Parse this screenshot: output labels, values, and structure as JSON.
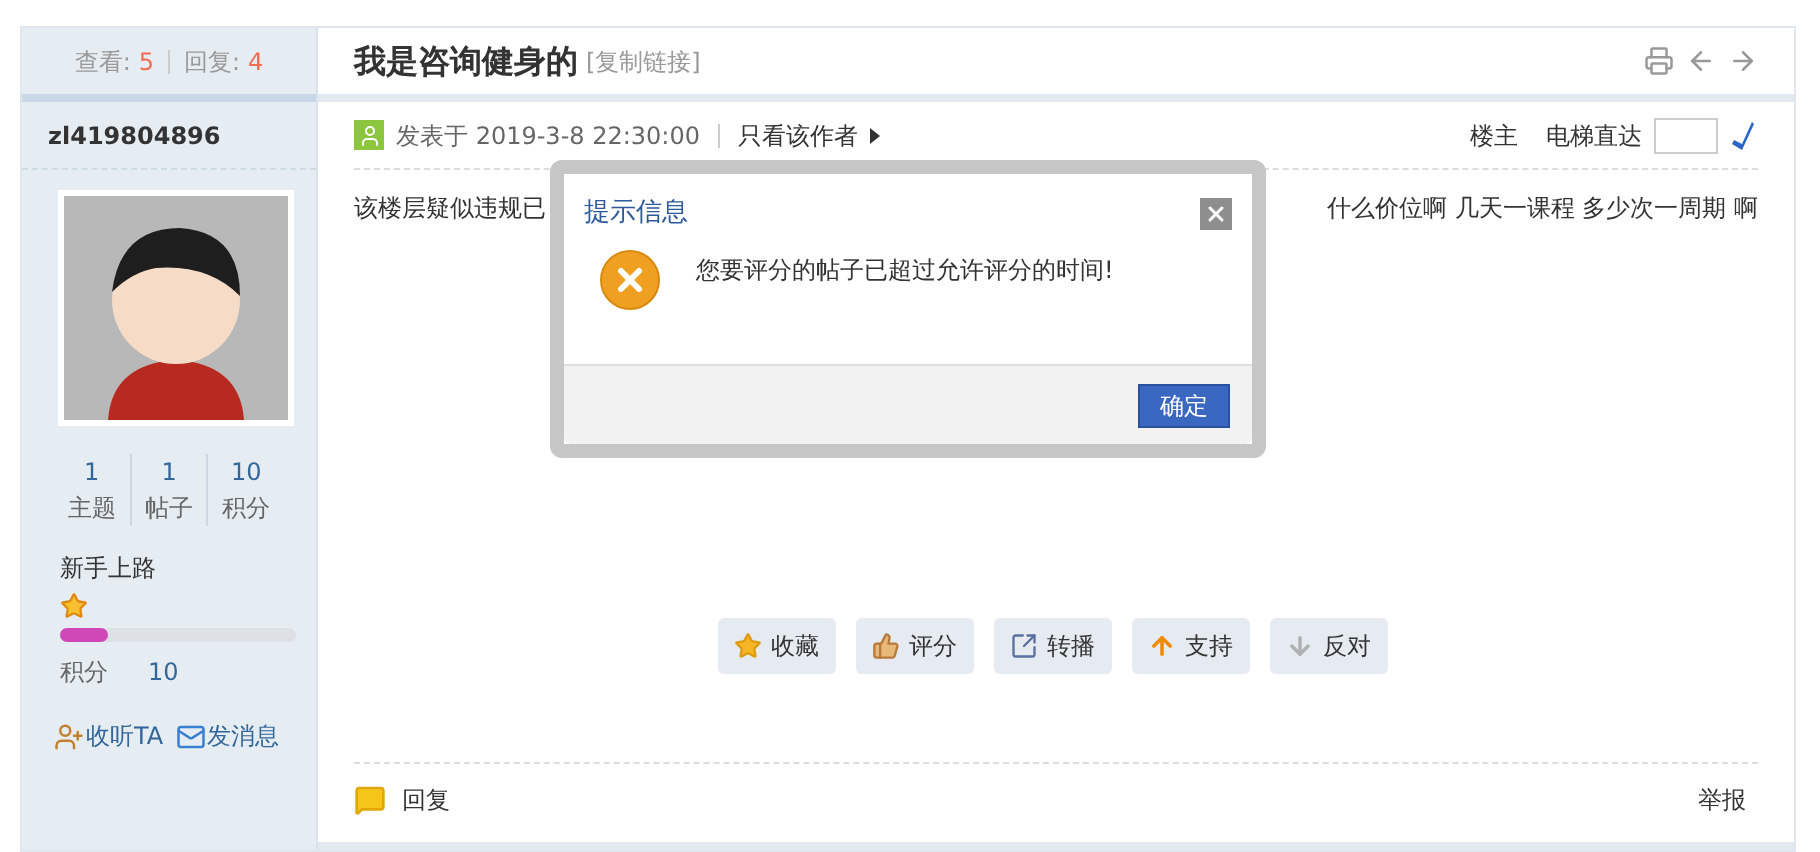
{
  "thread": {
    "views_label": "查看:",
    "views": "5",
    "replies_label": "回复:",
    "replies": "4",
    "title": "我是咨询健身的",
    "copy_link": "[复制链接]"
  },
  "author": {
    "name": "zl419804896",
    "stats": [
      {
        "value": "1",
        "label": "主题"
      },
      {
        "value": "1",
        "label": "帖子"
      },
      {
        "value": "10",
        "label": "积分"
      }
    ],
    "rank": "新手上路",
    "level": 0.2,
    "points_label": "积分",
    "points": "10",
    "actions": [
      {
        "kind": "follow",
        "label": "收听TA"
      },
      {
        "kind": "message",
        "label": "发消息"
      }
    ]
  },
  "post": {
    "posted": "发表于 2019-3-8 22:30:00",
    "author_only": "只看该作者",
    "floor": "楼主",
    "jump_label": "电梯直达",
    "content_visible": [
      "该楼层疑似违规已",
      "什么价位啊 几天一课程 多少次一周期 啊"
    ],
    "actions": [
      {
        "kind": "favorite",
        "label": "收藏"
      },
      {
        "kind": "rate",
        "label": "评分"
      },
      {
        "kind": "share",
        "label": "转播"
      },
      {
        "kind": "support",
        "label": "支持"
      },
      {
        "kind": "oppose",
        "label": "反对"
      }
    ],
    "reply": "回复",
    "report": "举报"
  },
  "dialog": {
    "title": "提示信息",
    "message": "您要评分的帖子已超过允许评分的时间!",
    "ok": "确定"
  }
}
